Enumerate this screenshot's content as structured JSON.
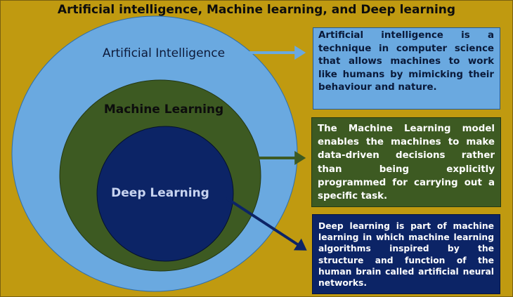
{
  "title": "Artificial intelligence, Machine learning, and Deep learning",
  "circles": {
    "ai_label": "Artificial Intelligence",
    "ml_label": "Machine Learning",
    "dl_label": "Deep Learning"
  },
  "descriptions": {
    "ai": "Artificial intelligence is a technique in computer science that allows machines to work like humans by mimicking their behaviour and nature.",
    "ml": "The Machine Learning model enables the machines to make data-driven decisions rather than being explicitly programmed for carrying out a specific task.",
    "dl": "Deep learning is part of machine learning in which machine learning algorithms inspired by the structure and function of the human brain called artificial neural networks."
  },
  "colors": {
    "background": "#c09a10",
    "ai": "#6aa9e0",
    "ml": "#3d5a22",
    "dl": "#0c2466"
  }
}
